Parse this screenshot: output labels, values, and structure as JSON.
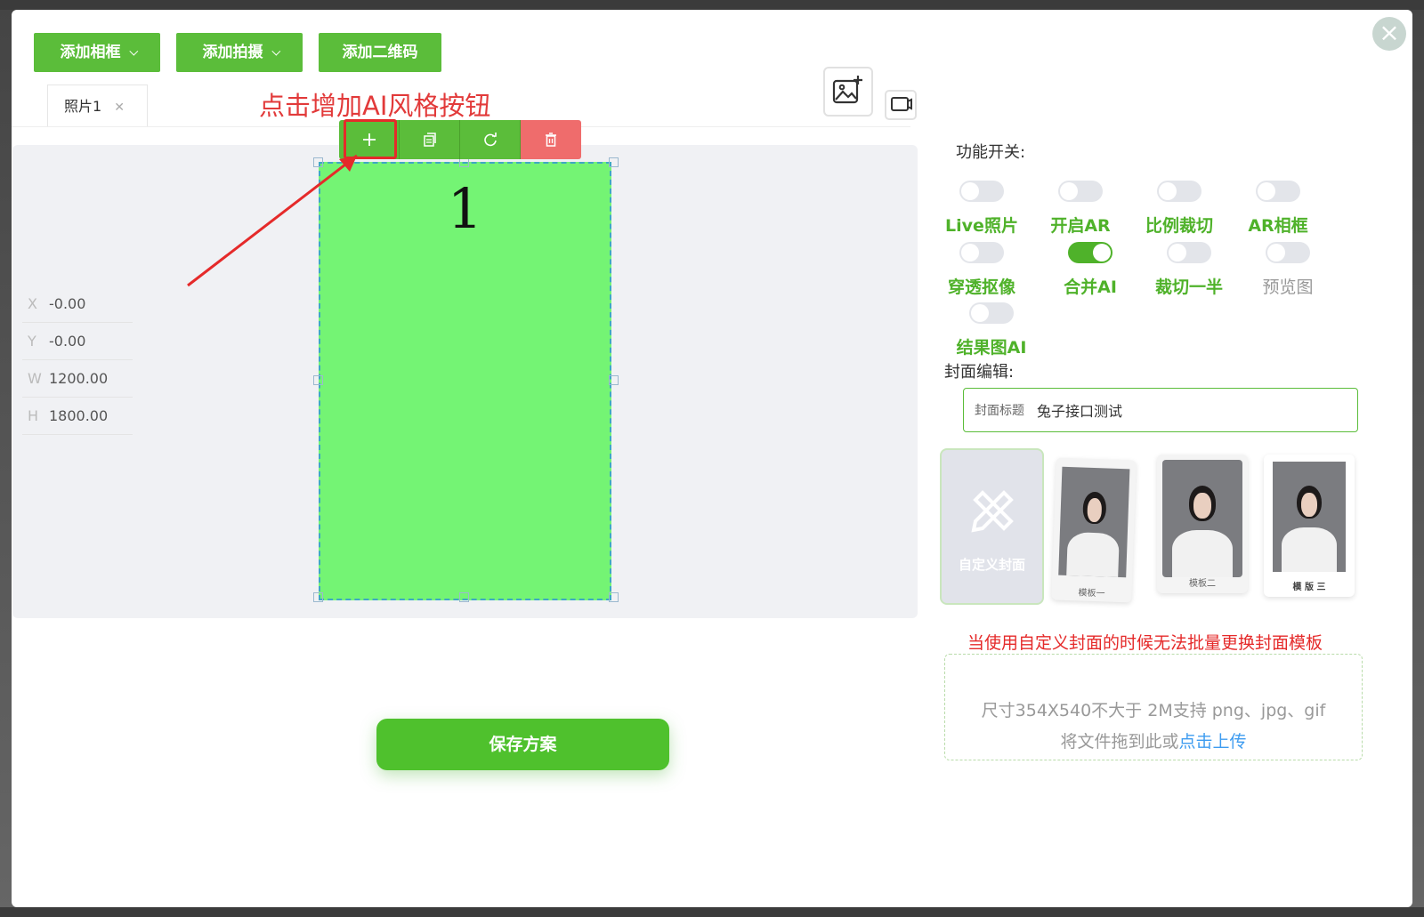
{
  "toolbar": {
    "add_frame": "添加相框",
    "add_shoot": "添加拍摄",
    "add_qrcode": "添加二维码"
  },
  "tabs": [
    {
      "label": "照片1"
    }
  ],
  "hint": "点击增加AI风格按钮",
  "frame": {
    "number": "1",
    "fill_color": "#74f474"
  },
  "coords": {
    "x_label": "X",
    "x": "-0.00",
    "y_label": "Y",
    "y": "-0.00",
    "w_label": "W",
    "w": "1200.00",
    "h_label": "H",
    "h": "1800.00"
  },
  "save_button": "保存方案",
  "features": {
    "title": "功能开关:",
    "items": [
      {
        "label": "Live照片",
        "on": false
      },
      {
        "label": "开启AR",
        "on": false
      },
      {
        "label": "比例裁切",
        "on": false
      },
      {
        "label": "AR相框",
        "on": false
      },
      {
        "label": "穿透抠像",
        "on": false
      },
      {
        "label": "合并AI",
        "on": true
      },
      {
        "label": "裁切一半",
        "on": false
      },
      {
        "label": "预览图",
        "on": false
      },
      {
        "label": "结果图AI",
        "on": false
      }
    ]
  },
  "cover": {
    "title": "封面编辑:",
    "input_label": "封面标题",
    "input_value": "兔子接口测试",
    "custom_label": "自定义封面",
    "templates": [
      {
        "label": "模板一"
      },
      {
        "label": "模板二"
      },
      {
        "label": "模 版 三"
      }
    ]
  },
  "warning": "当使用自定义封面的时候无法批量更换封面模板",
  "upload": {
    "line1": "尺寸354X540不大于 2M支持 png、jpg、gif",
    "line2_prefix": "将文件拖到此或",
    "line2_link": "点击上传"
  },
  "colors": {
    "accent": "#5bbd3a",
    "danger": "#ef6c6c",
    "hint": "#e23a3a",
    "link": "#3e9cf0"
  }
}
